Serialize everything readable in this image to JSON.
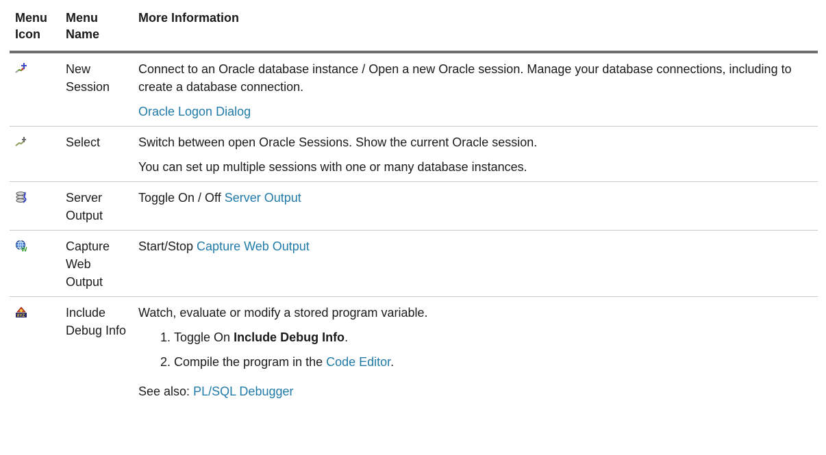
{
  "headers": {
    "icon": "Menu Icon",
    "name": "Menu Name",
    "info": "More Information"
  },
  "rows": [
    {
      "icon": "new-session-icon",
      "name": "New Session",
      "p1": "Connect to an Oracle database instance / Open a new Oracle session. Manage your database connections, including to create a database connection.",
      "link": "Oracle Logon Dialog"
    },
    {
      "icon": "select-session-icon",
      "name": "Select",
      "p1": "Switch between open Oracle Sessions. Show the current Oracle session.",
      "p2": "You can set up multiple sessions with one or many database instances."
    },
    {
      "icon": "server-output-icon",
      "name": "Server Output",
      "prefix": "Toggle On / Off ",
      "link": "Server Output"
    },
    {
      "icon": "capture-web-output-icon",
      "name": "Capture Web Output",
      "prefix": "Start/Stop ",
      "link": "Capture Web Output"
    },
    {
      "icon": "debug-info-icon",
      "name": "Include Debug Info",
      "p1": "Watch, evaluate or modify a stored program variable.",
      "step1_prefix": "Toggle On ",
      "step1_bold": "Include Debug Info",
      "step1_suffix": ".",
      "step2_prefix": "Compile the program in the ",
      "step2_link": "Code Editor",
      "step2_suffix": ".",
      "see_also_prefix": "See also: ",
      "see_also_link": "PL/SQL Debugger"
    }
  ]
}
